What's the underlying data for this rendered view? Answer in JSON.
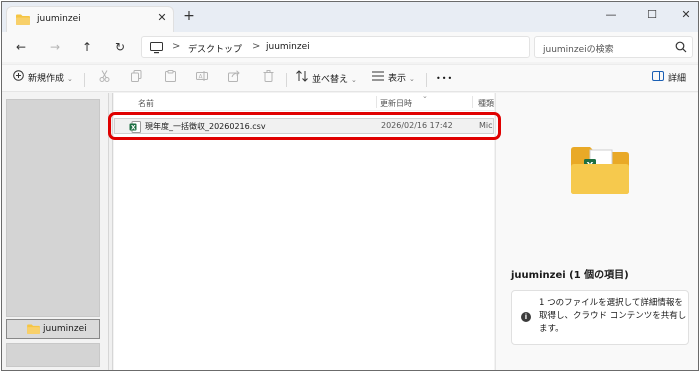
{
  "window": {
    "tab_title": "juuminzei",
    "new_tab_symbol": "+",
    "close_tab_symbol": "✕",
    "controls": {
      "minimize": "—",
      "maximize": "☐",
      "close": "✕"
    }
  },
  "navigation": {
    "back": "←",
    "forward": "→",
    "up": "↑",
    "refresh": "↻",
    "breadcrumb": [
      "デスクトップ",
      "juuminzei"
    ],
    "separator": ">",
    "search_placeholder": "juuminzeiの検索"
  },
  "toolbar": {
    "new_label": "新規作成",
    "sort_label": "並べ替え",
    "view_label": "表示",
    "more_label": "•••",
    "details_label": "詳細",
    "icons": [
      "cut-icon",
      "copy-icon",
      "paste-icon",
      "rename-icon",
      "share-icon",
      "delete-icon"
    ]
  },
  "sidebar": {
    "selected_folder": "juuminzei"
  },
  "file_list": {
    "columns": {
      "name": "名前",
      "modified": "更新日時",
      "type": "種類"
    },
    "rows": [
      {
        "name": "現年度_一括徴収_20260216.csv",
        "modified": "2026/02/16 17:42",
        "type": "Mic",
        "icon": "excel-csv-icon"
      }
    ]
  },
  "details_pane": {
    "title": "juuminzei (1 個の項目)",
    "info_text": "1 つのファイルを選択して詳細情報を取得し、クラウド コンテンツを共有します。"
  },
  "colors": {
    "highlight": "#e00000",
    "folder": "#f5c542",
    "excel": "#1d6f42"
  }
}
